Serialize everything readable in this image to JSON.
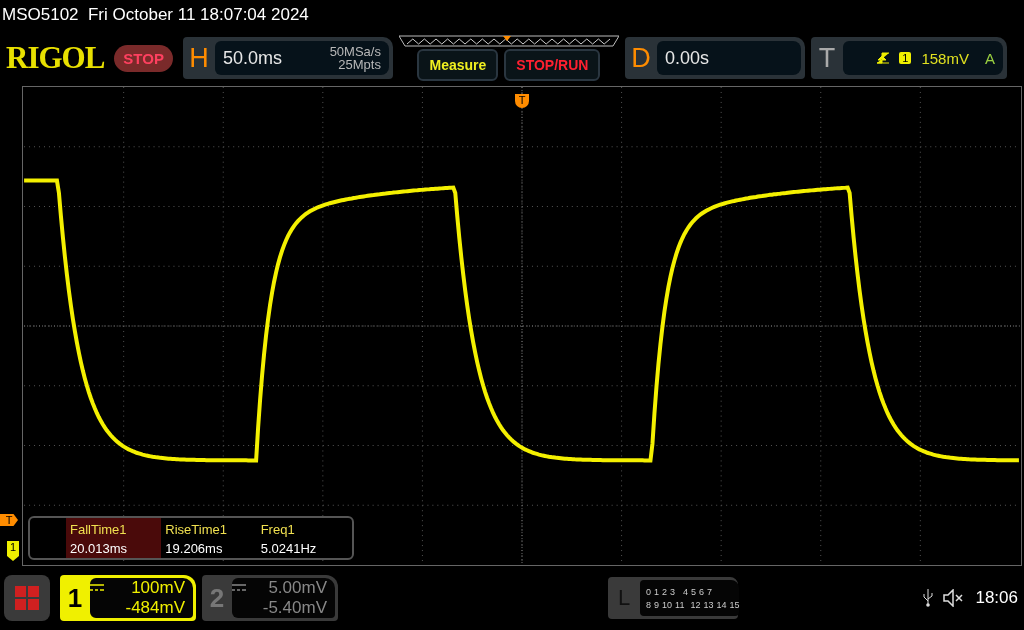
{
  "status_line": "MSO5102  Fri October 11 18:07:04 2024",
  "logo": "RIGOL",
  "run_state": "STOP",
  "horizontal": {
    "letter": "H",
    "timebase": "50.0ms",
    "sample_rate": "50MSa/s",
    "memory_depth": "25Mpts"
  },
  "buttons": [
    {
      "label": "Measure",
      "kind": "measure"
    },
    {
      "label": "STOP/RUN",
      "kind": "run"
    }
  ],
  "delay": {
    "letter": "D",
    "value": "0.00s"
  },
  "trigger": {
    "letter": "T",
    "channel": "1",
    "level": "158mV",
    "mode": "A"
  },
  "markers": {
    "top_trigger": "T",
    "left_trigger": "T",
    "left_channel": "1"
  },
  "measurements": [
    {
      "name": "FallTime1",
      "value": "20.013ms",
      "selected": true
    },
    {
      "name": "RiseTime1",
      "value": "19.206ms",
      "selected": false
    },
    {
      "name": "Freq1",
      "value": "5.0241Hz",
      "selected": false
    }
  ],
  "channels": [
    {
      "number": "1",
      "scale": "100mV",
      "offset": "-484mV",
      "on": true
    },
    {
      "number": "2",
      "scale": "5.00mV",
      "offset": "-5.40mV",
      "on": false
    }
  ],
  "logic": {
    "letter": "L",
    "row_1": [
      "0",
      "1",
      "2",
      "3",
      "4",
      "5",
      "6",
      "7"
    ],
    "row_2": [
      "8",
      "9",
      "10",
      "11",
      "12",
      "13",
      "14",
      "15"
    ]
  },
  "clock": "18:06"
}
